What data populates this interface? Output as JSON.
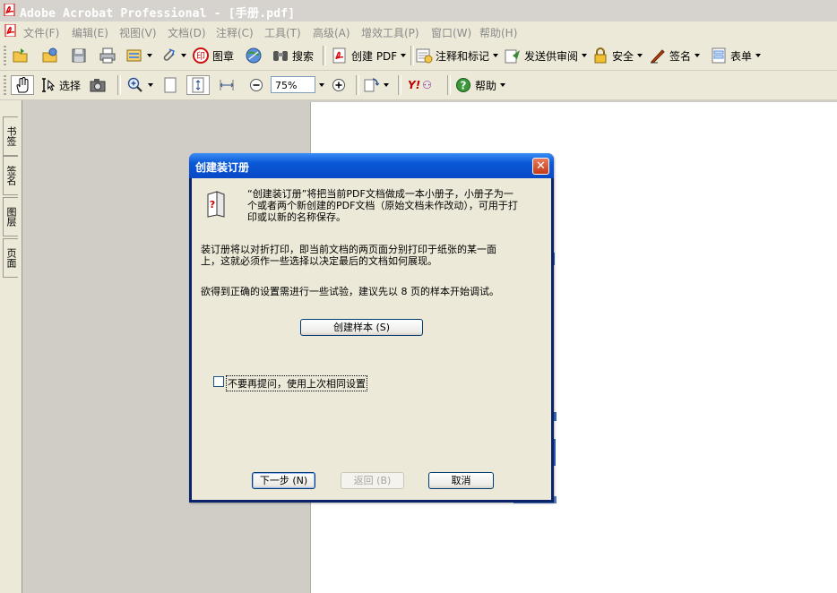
{
  "window": {
    "title": "Adobe Acrobat Professional - [手册.pdf]"
  },
  "menu": {
    "items": [
      "文件(F)",
      "编辑(E)",
      "视图(V)",
      "文档(D)",
      "注释(C)",
      "工具(T)",
      "高级(A)",
      "增效工具(P)",
      "窗口(W)",
      "帮助(H)"
    ]
  },
  "toolbar1": {
    "stamp_label": "图章",
    "search_label": "搜索",
    "create_pdf_label": "创建 PDF",
    "comment_label": "注释和标记",
    "send_review_label": "发送供审阅",
    "security_label": "安全",
    "sign_label": "签名",
    "forms_label": "表单"
  },
  "toolbar2": {
    "select_label": "选择",
    "zoom_value": "75%",
    "yahoo_label": "Y!",
    "help_label": "帮助"
  },
  "side_tabs": [
    "书签",
    "签名",
    "图层",
    "页面"
  ],
  "dialog": {
    "title": "创建装订册",
    "intro_line1": "“创建装订册”将把当前PDF文档做成一本小册子，小册子为一",
    "intro_line2": "个或者两个新创建的PDF文档（原始文档未作改动），可用于打",
    "intro_line3": "印或以新的名称保存。",
    "para2_line1": "装订册将以对折打印，即当前文档的两页面分别打印于纸张的某一面",
    "para2_line2": "上，这就必须作一些选择以决定最后的文档如何展现。",
    "para3": "欲得到正确的设置需进行一些试验，建议先以 8 页的样本开始调试。",
    "create_sample_button": "创建样本 (S)",
    "checkbox_label": "不要再提问，使用上次相同设置",
    "checkbox_checked": false,
    "next_button": "下一步 (N)",
    "back_button": "返回 (B)",
    "cancel_button": "取消"
  }
}
